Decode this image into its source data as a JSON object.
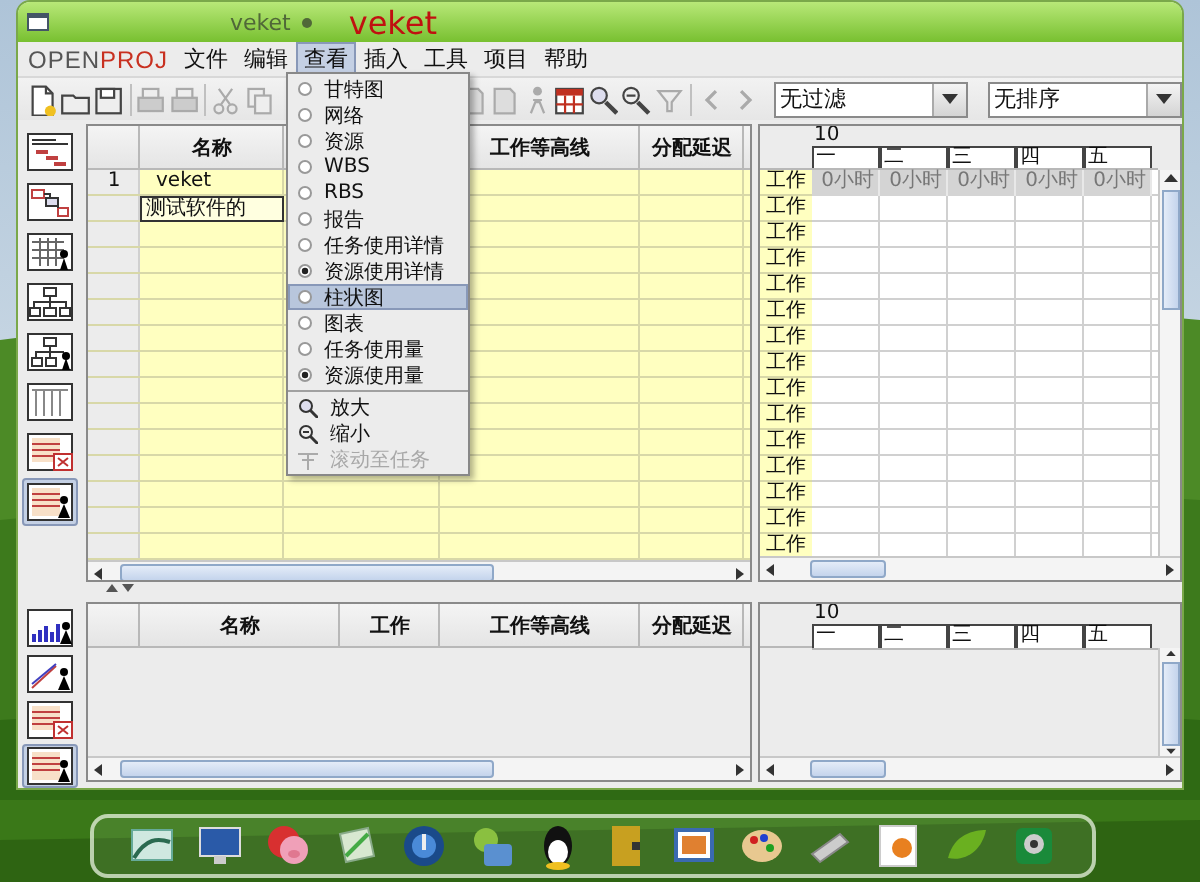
{
  "window": {
    "subtitle": "veket",
    "title": "veket"
  },
  "menu_bar": {
    "logo": [
      "OPEN",
      "PROJ"
    ],
    "items": [
      {
        "label": "文件",
        "selected": false
      },
      {
        "label": "编辑",
        "selected": false
      },
      {
        "label": "查看",
        "selected": true
      },
      {
        "label": "插入",
        "selected": false
      },
      {
        "label": "工具",
        "selected": false
      },
      {
        "label": "项目",
        "selected": false
      },
      {
        "label": "帮助",
        "selected": false
      }
    ]
  },
  "view_menu": {
    "items": [
      {
        "kind": "radio",
        "label": "甘特图",
        "checked": false,
        "selected": false,
        "disabled": false
      },
      {
        "kind": "radio",
        "label": "网络",
        "checked": false,
        "selected": false,
        "disabled": false
      },
      {
        "kind": "radio",
        "label": "资源",
        "checked": false,
        "selected": false,
        "disabled": false
      },
      {
        "kind": "radio",
        "label": "WBS",
        "checked": false,
        "selected": false,
        "disabled": false
      },
      {
        "kind": "radio",
        "label": "RBS",
        "checked": false,
        "selected": false,
        "disabled": false
      },
      {
        "kind": "radio",
        "label": "报告",
        "checked": false,
        "selected": false,
        "disabled": false
      },
      {
        "kind": "radio",
        "label": "任务使用详情",
        "checked": false,
        "selected": false,
        "disabled": false
      },
      {
        "kind": "radio",
        "label": "资源使用详情",
        "checked": true,
        "selected": false,
        "disabled": false
      },
      {
        "kind": "radio",
        "label": "柱状图",
        "checked": false,
        "selected": true,
        "disabled": false
      },
      {
        "kind": "radio",
        "label": "图表",
        "checked": false,
        "selected": false,
        "disabled": false
      },
      {
        "kind": "radio",
        "label": "任务使用量",
        "checked": false,
        "selected": false,
        "disabled": false
      },
      {
        "kind": "radio",
        "label": "资源使用量",
        "checked": true,
        "selected": false,
        "disabled": false
      },
      {
        "kind": "zoom_in",
        "label": "放大",
        "selected": false,
        "disabled": false
      },
      {
        "kind": "zoom_out",
        "label": "缩小",
        "selected": false,
        "disabled": false
      },
      {
        "kind": "scroll",
        "label": "滚动至任务",
        "selected": false,
        "disabled": true
      }
    ]
  },
  "filter": {
    "value": "无过滤"
  },
  "sort": {
    "value": "无排序"
  },
  "top_sidebar": [
    {
      "kind": "gantt",
      "selected": false
    },
    {
      "kind": "network",
      "selected": false
    },
    {
      "kind": "resources",
      "selected": false
    },
    {
      "kind": "wbs",
      "selected": false
    },
    {
      "kind": "rbs",
      "selected": false
    },
    {
      "kind": "report",
      "selected": false
    },
    {
      "kind": "task_usage",
      "selected": false
    },
    {
      "kind": "resource_usage",
      "selected": true
    }
  ],
  "top_table": {
    "columns": [
      {
        "label": "名称"
      },
      {},
      {
        "label": "工作等高线"
      },
      {
        "label": "分配延迟"
      }
    ],
    "rows": [
      {
        "number": "1",
        "name": "veket",
        "editing": false
      },
      {
        "name": "测试软件的",
        "editing": true
      }
    ]
  },
  "top_usage": {
    "month": "10",
    "days": [
      "一",
      "二",
      "三",
      "四",
      "五"
    ],
    "rows": [
      {
        "label": "工作",
        "values": [
          "0小时",
          "0小时",
          "0小时",
          "0小时",
          "0小时"
        ]
      },
      {
        "label": "工作"
      },
      {
        "label": "工作"
      },
      {
        "label": "工作"
      },
      {
        "label": "工作"
      },
      {
        "label": "工作"
      },
      {
        "label": "工作"
      },
      {
        "label": "工作"
      },
      {
        "label": "工作"
      },
      {
        "label": "工作"
      },
      {
        "label": "工作"
      },
      {
        "label": "工作"
      },
      {
        "label": "工作"
      },
      {
        "label": "工作"
      },
      {
        "label": "工作"
      }
    ]
  },
  "bottom_sidebar": [
    {
      "kind": "histogram",
      "selected": false
    },
    {
      "kind": "charts",
      "selected": false
    },
    {
      "kind": "task_usage",
      "selected": false
    },
    {
      "kind": "resource_usage",
      "selected": true
    }
  ],
  "bottom_table": {
    "columns": [
      {
        "label": "名称"
      },
      {
        "label": "工作"
      },
      {
        "label": "工作等高线"
      },
      {
        "label": "分配延迟"
      }
    ]
  },
  "bottom_usage": {
    "month": "10",
    "days": [
      "一",
      "二",
      "三",
      "四",
      "五"
    ]
  }
}
